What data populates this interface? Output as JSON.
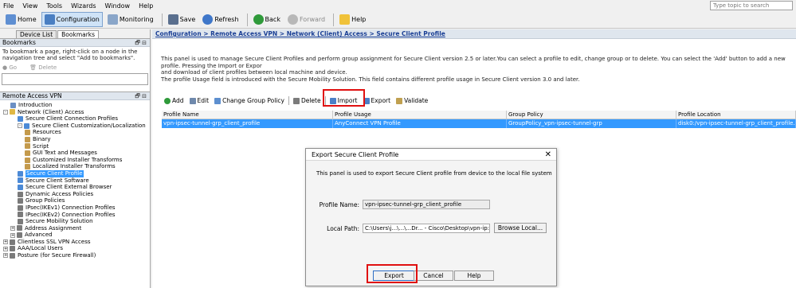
{
  "menu": [
    "File",
    "View",
    "Tools",
    "Wizards",
    "Window",
    "Help"
  ],
  "search": {
    "placeholder": "Type topic to search"
  },
  "toolbar": {
    "home": "Home",
    "configuration": "Configuration",
    "monitoring": "Monitoring",
    "save": "Save",
    "refresh": "Refresh",
    "back": "Back",
    "forward": "Forward",
    "help": "Help"
  },
  "left": {
    "tabs": [
      "Device List",
      "Bookmarks"
    ],
    "bookmarks_title": "Bookmarks",
    "bookmarks_help": "To bookmark a page, right-click on a node in the navigation tree and select \"Add to bookmarks\".",
    "go": "Go",
    "delete": "Delete",
    "nav_title": "Remote Access VPN",
    "tree": [
      {
        "label": "Introduction",
        "indent": 1,
        "color": "#6b8fc4"
      },
      {
        "label": "Network (Client) Access",
        "indent": 0,
        "color": "#e1b844",
        "exp": "-"
      },
      {
        "label": "Secure Client Connection Profiles",
        "indent": 2,
        "color": "#4c8ad6"
      },
      {
        "label": "Secure Client Customization/Localization",
        "indent": 2,
        "color": "#4c8ad6",
        "exp": "-"
      },
      {
        "label": "Resources",
        "indent": 3,
        "color": "#c49a4c"
      },
      {
        "label": "Binary",
        "indent": 3,
        "color": "#c49a4c"
      },
      {
        "label": "Script",
        "indent": 3,
        "color": "#c49a4c"
      },
      {
        "label": "GUI Text and Messages",
        "indent": 3,
        "color": "#c49a4c"
      },
      {
        "label": "Customized Installer Transforms",
        "indent": 3,
        "color": "#c49a4c"
      },
      {
        "label": "Localized Installer Transforms",
        "indent": 3,
        "color": "#c49a4c"
      },
      {
        "label": "Secure Client Profile",
        "indent": 2,
        "color": "#4c8ad6",
        "selected": true
      },
      {
        "label": "Secure Client Software",
        "indent": 2,
        "color": "#4c8ad6"
      },
      {
        "label": "Secure Client External Browser",
        "indent": 2,
        "color": "#4c8ad6"
      },
      {
        "label": "Dynamic Access Policies",
        "indent": 2,
        "color": "#7a7a7a"
      },
      {
        "label": "Group Policies",
        "indent": 2,
        "color": "#7a7a7a"
      },
      {
        "label": "IPsec(IKEv1) Connection Profiles",
        "indent": 2,
        "color": "#7a7a7a"
      },
      {
        "label": "IPsec(IKEv2) Connection Profiles",
        "indent": 2,
        "color": "#7a7a7a"
      },
      {
        "label": "Secure Mobility Solution",
        "indent": 2,
        "color": "#7a7a7a"
      },
      {
        "label": "Address Assignment",
        "indent": 1,
        "color": "#7a7a7a",
        "exp": "+"
      },
      {
        "label": "Advanced",
        "indent": 1,
        "color": "#7a7a7a",
        "exp": "+"
      },
      {
        "label": "Clientless SSL VPN Access",
        "indent": 0,
        "color": "#7a7a7a",
        "exp": "+"
      },
      {
        "label": "AAA/Local Users",
        "indent": 0,
        "color": "#7a7a7a",
        "exp": "+"
      },
      {
        "label": "Posture (for Secure Firewall)",
        "indent": 0,
        "color": "#7a7a7a",
        "exp": "+"
      }
    ]
  },
  "breadcrumb": "Configuration > Remote Access VPN > Network (Client) Access > Secure Client Profile",
  "description": {
    "line1": "This panel is used to manage Secure Client Profiles and perform group assignment for Secure Client version 2.5 or later.You can select a profile to edit, change group or to delete. You can select the 'Add' button to add a new profile. Pressing the Import or Expor",
    "line2": "and download of client profiles between local machine and device.",
    "line3": "The profile Usage field is introduced with the Secure Mobility Solution. This field contains different profile usage in Secure Client version 3.0 and later."
  },
  "actions": {
    "add": "Add",
    "edit": "Edit",
    "change_group": "Change Group Policy",
    "delete": "Delete",
    "import": "Import",
    "export": "Export",
    "validate": "Validate"
  },
  "table": {
    "headers": [
      "Profile Name",
      "Profile Usage",
      "Group Policy",
      "Profile Location"
    ],
    "rows": [
      [
        "vpn-ipsec-tunnel-grp_client_profile",
        "AnyConnect VPN Profile",
        "GroupPolicy_vpn-ipsec-tunnel-grp",
        "disk0:/vpn-ipsec-tunnel-grp_client_profile.xml"
      ]
    ]
  },
  "dialog": {
    "title": "Export Secure Client Profile",
    "close": "✕",
    "description": "This panel is used to export Secure Client profile from device to the local file system",
    "profile_name_label": "Profile Name:",
    "profile_name_value": "vpn-ipsec-tunnel-grp_client_profile",
    "local_path_label": "Local Path:",
    "local_path_value": "C:\\Users\\j...\\...\\...Dr... - Cisco\\Desktop\\vpn-ip:",
    "browse": "Browse Local...",
    "export": "Export",
    "cancel": "Cancel",
    "help": "Help"
  },
  "colors": {
    "selection": "#3399ff",
    "highlight": "#e01010",
    "breadcrumb": "#1a3f95"
  }
}
